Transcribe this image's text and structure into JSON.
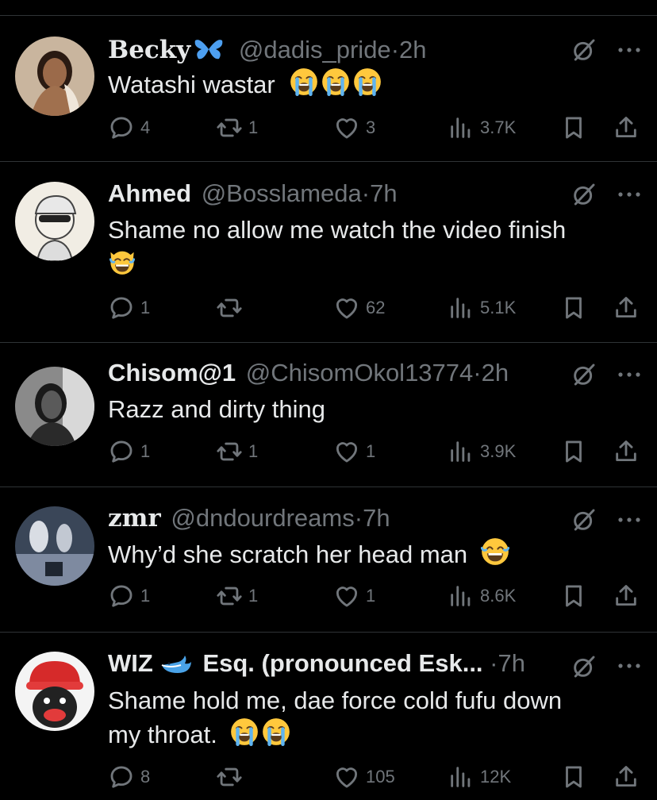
{
  "tweets": [
    {
      "display_name": "Becky",
      "display_name_suffix_icon": "butterfly-icon",
      "handle": "@dadis_pride",
      "separator": "·",
      "time": "2h",
      "text": "Watashi wastar",
      "text_emoji": [
        "loudly-crying-face",
        "loudly-crying-face",
        "loudly-crying-face"
      ],
      "replies": "4",
      "reposts": "1",
      "likes": "3",
      "views": "3.7K"
    },
    {
      "display_name": "Ahmed",
      "handle": "@Bosslameda",
      "separator": "·",
      "time": "7h",
      "text": "Shame no allow me watch the video finish",
      "text_emoji": [
        "cat-with-tears-of-joy"
      ],
      "replies": "1",
      "reposts": "",
      "likes": "62",
      "views": "5.1K"
    },
    {
      "display_name": "Chisom@1",
      "handle": "@ChisomOkol13774",
      "separator": "·",
      "time": "2h",
      "text": "Razz and dirty thing",
      "text_emoji": [],
      "replies": "1",
      "reposts": "1",
      "likes": "1",
      "views": "3.9K"
    },
    {
      "display_name": "zmr",
      "handle": "@dndourdreams",
      "separator": "·",
      "time": "7h",
      "text": "Why’d she scratch her head man",
      "text_emoji": [
        "face-with-tears-of-joy"
      ],
      "replies": "1",
      "reposts": "1",
      "likes": "1",
      "views": "8.6K"
    },
    {
      "display_name": "WIZ",
      "display_name_middle_icon": "whale-icon",
      "display_name_rest": "Esq. (pronounced Esk...",
      "handle": "",
      "separator": "·",
      "time": "7h",
      "text_line1": "Shame hold me, dae force cold fufu down",
      "text_line2": "my throat.",
      "text_emoji": [
        "loudly-crying-face",
        "loudly-crying-face"
      ],
      "replies": "8",
      "reposts": "",
      "likes": "105",
      "views": "12K"
    }
  ],
  "colors": {
    "background": "#000000",
    "text": "#e7e9ea",
    "muted": "#71767b",
    "divider": "#2f3336",
    "emoji": "#ffc83d",
    "tears": "#5fb4f0"
  }
}
